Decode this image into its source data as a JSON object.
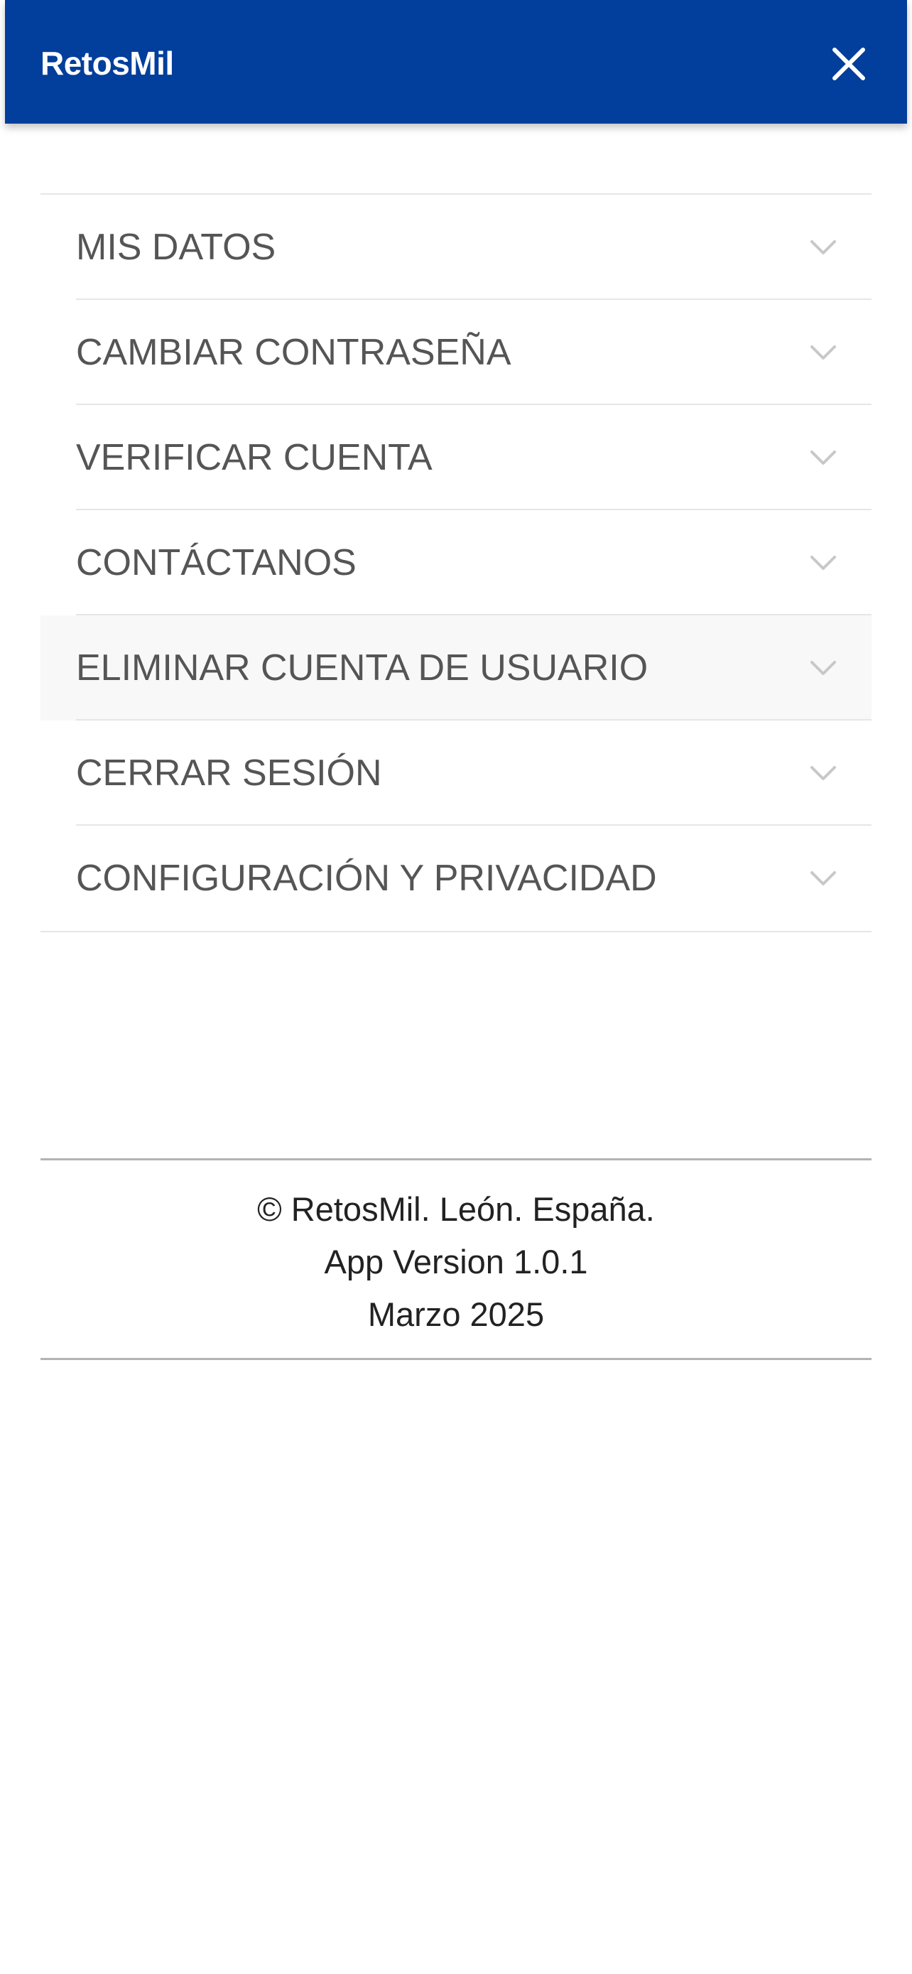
{
  "header": {
    "title": "RetosMil",
    "close_icon": "close-icon",
    "background": "#023e9b"
  },
  "menu": {
    "items": [
      {
        "label": "MIS DATOS"
      },
      {
        "label": "CAMBIAR CONTRASEÑA"
      },
      {
        "label": "VERIFICAR CUENTA"
      },
      {
        "label": "CONTÁCTANOS"
      },
      {
        "label": "ELIMINAR CUENTA DE USUARIO"
      },
      {
        "label": "CERRAR SESIÓN"
      },
      {
        "label": "CONFIGURACIÓN Y PRIVACIDAD"
      }
    ],
    "expand_icon": "chevron-down-icon"
  },
  "footer": {
    "copyright": "© RetosMil. León. España.",
    "version": "App Version 1.0.1",
    "date": "Marzo 2025"
  }
}
